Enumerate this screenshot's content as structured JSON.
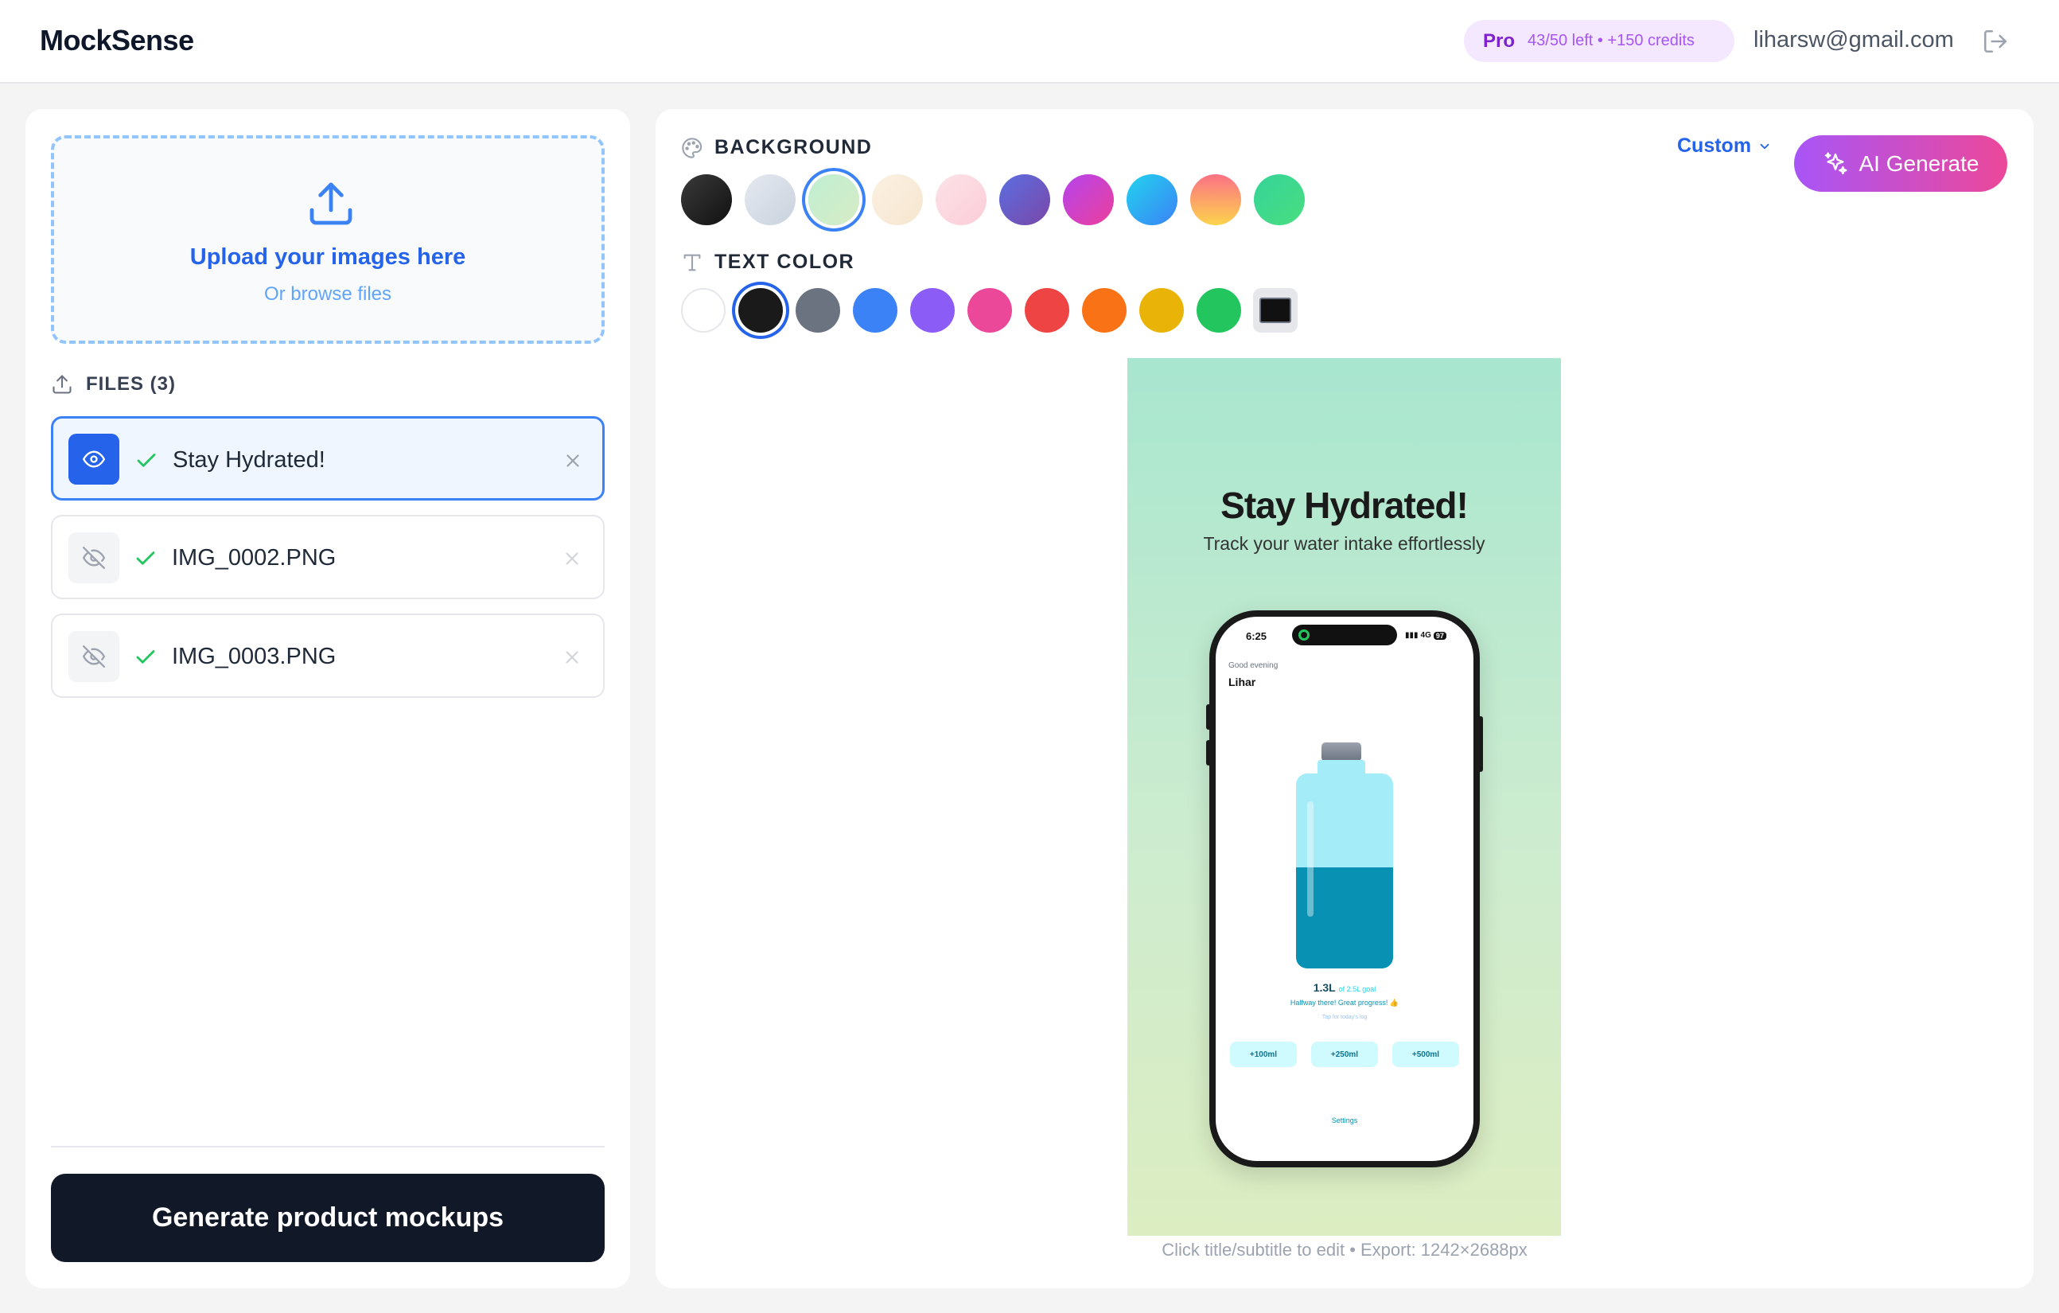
{
  "header": {
    "logo": "MockSense",
    "plan": "Pro",
    "credits": "43/50 left • +150 credits",
    "email": "liharsw@gmail.com"
  },
  "upload": {
    "title": "Upload your images here",
    "subtitle": "Or browse files"
  },
  "files": {
    "header": "FILES (3)",
    "items": [
      {
        "name": "Stay Hydrated!",
        "active": true
      },
      {
        "name": "IMG_0002.PNG",
        "active": false
      },
      {
        "name": "IMG_0003.PNG",
        "active": false
      }
    ]
  },
  "generate_button": "Generate product mockups",
  "background": {
    "label": "BACKGROUND",
    "custom_label": "Custom",
    "selected_index": 2,
    "swatches": [
      "linear-gradient(135deg,#3a3a3a,#111111)",
      "linear-gradient(135deg,#e5e9f0,#c9d2de)",
      "linear-gradient(135deg,#bfeed3,#d7ecc4)",
      "linear-gradient(135deg,#fbf0e2,#f6e6cf)",
      "linear-gradient(135deg,#fde2e7,#fbcdd7)",
      "linear-gradient(135deg,#5b6ee1,#7a47a8)",
      "linear-gradient(135deg,#b544ee,#ec3f9a)",
      "linear-gradient(135deg,#22d3ee,#3b82f6)",
      "linear-gradient(180deg,#fb7185,#fcd34d)",
      "linear-gradient(135deg,#34d399,#4ade80)"
    ]
  },
  "ai_button": "AI Generate",
  "text_color": {
    "label": "TEXT COLOR",
    "selected_index": 1,
    "swatches": [
      "#ffffff",
      "#1a1a1a",
      "#6b7280",
      "#3b82f6",
      "#8b5cf6",
      "#ec4899",
      "#ef4444",
      "#f97316",
      "#eab308",
      "#22c55e"
    ]
  },
  "preview": {
    "title": "Stay Hydrated!",
    "subtitle": "Track your water intake effortlessly",
    "phone": {
      "time": "6:25",
      "network": "4G",
      "battery": "97",
      "greeting": "Good evening",
      "name": "Lihar",
      "amount": "1.3L",
      "goal": "of 2.5L goal",
      "fill_fraction": 0.52,
      "progress_msg": "Halfway there! Great progress! 👍",
      "tap_msg": "Tap for today's log",
      "buttons": [
        "+100ml",
        "+250ml",
        "+500ml"
      ],
      "settings": "Settings"
    }
  },
  "export_note": "Click title/subtitle to edit • Export: 1242×2688px"
}
